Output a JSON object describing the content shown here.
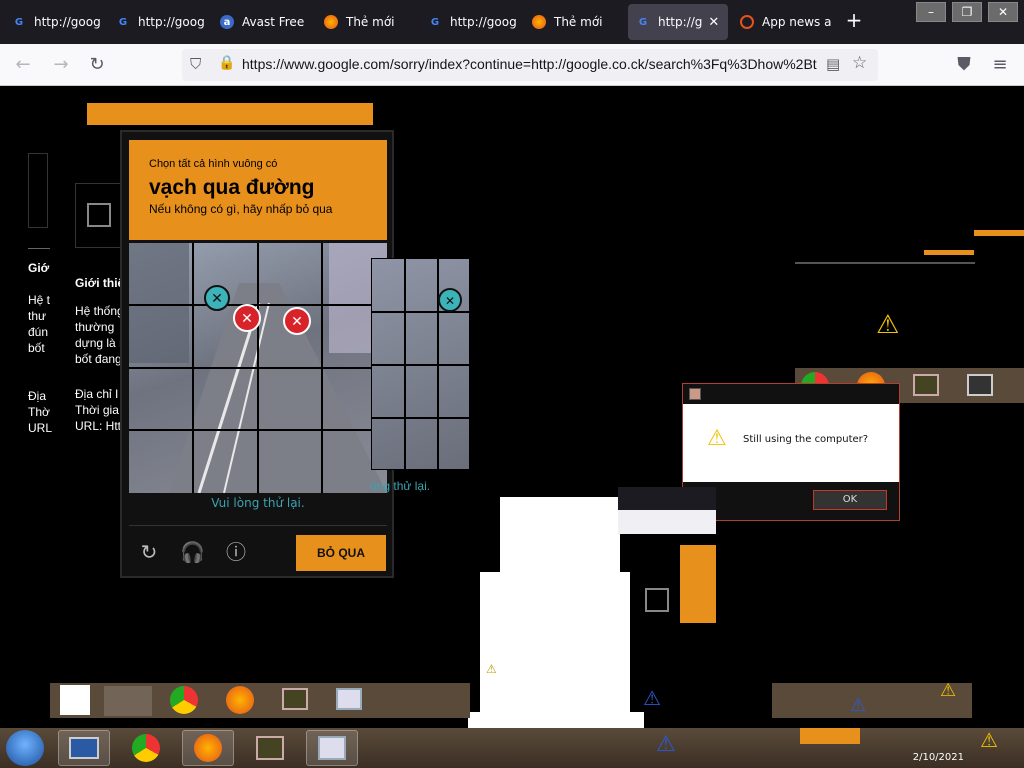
{
  "browser": {
    "tabs": [
      {
        "title": "http://goog",
        "favicon": "google-icon",
        "active": false
      },
      {
        "title": "http://goog",
        "favicon": "google-icon",
        "active": false
      },
      {
        "title": "Avast Free",
        "favicon": "avast-icon",
        "active": false
      },
      {
        "title": "Thẻ mới",
        "favicon": "firefox-icon",
        "active": false
      },
      {
        "title": "http://goog",
        "favicon": "google-icon",
        "active": false
      },
      {
        "title": "Thẻ mới",
        "favicon": "firefox-icon",
        "active": false
      },
      {
        "title": "http://g",
        "favicon": "google-icon",
        "active": true
      },
      {
        "title": "App news a",
        "favicon": "app-icon",
        "active": false
      }
    ],
    "url": "https://www.google.com/sorry/index?continue=http://google.co.ck/search%3Fq%3Dhow%2Bt"
  },
  "captcha": {
    "line1": "Chọn tất cả hình vuông có",
    "line2": "vạch qua đường",
    "line3": "Nếu không có gì, hãy nhấp bỏ qua",
    "retry_msg": "Vui lòng thử lại.",
    "retry_msg_ghost": "òng thử lại.",
    "skip_label": "BỎ QUA"
  },
  "sidebar_ghost": {
    "heading_partial": "Giớ",
    "heading2_partial": "Giới thiệ",
    "para_lines": [
      "Hệ t",
      "thư",
      "đún",
      "bốt"
    ],
    "para2_lines": [
      "Hệ thống",
      "thường",
      "dựng là r",
      "bốt đang"
    ],
    "addr_lines": [
      "Địa",
      "Thờ",
      "URL"
    ],
    "addr2_lines": [
      "Địa chỉ I",
      "Thời gia",
      "URL: Http"
    ]
  },
  "dialog": {
    "message": "Still using the computer?",
    "ok_label": "OK"
  },
  "taskbar": {
    "clock": "2/10/2021"
  },
  "colors": {
    "captcha_orange": "#e8901c",
    "dialog_border": "#b04030",
    "taskbar": "#3b2f24"
  }
}
